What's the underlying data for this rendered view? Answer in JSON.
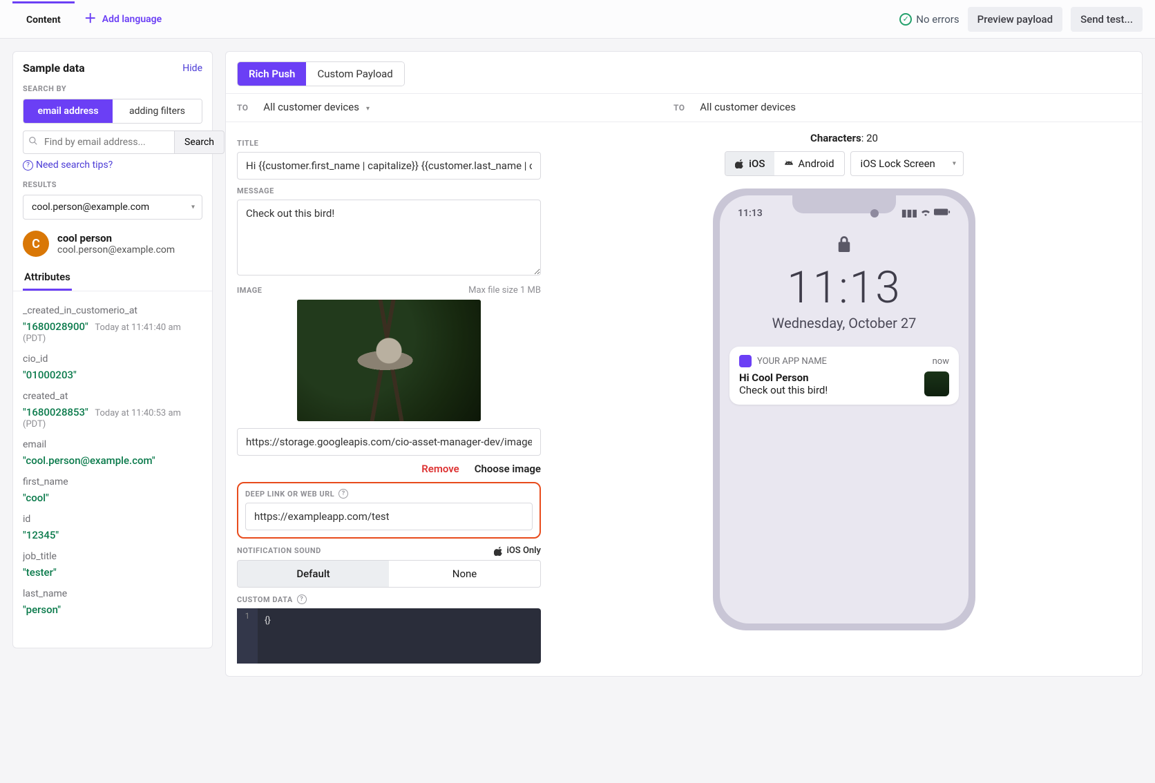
{
  "topbar": {
    "tab": "Content",
    "add_language": "Add language",
    "no_errors": "No errors",
    "preview_payload": "Preview payload",
    "send_test": "Send test..."
  },
  "sidebar": {
    "title": "Sample data",
    "hide": "Hide",
    "search_by": "SEARCH BY",
    "toggle": {
      "email": "email address",
      "filters": "adding filters"
    },
    "search_placeholder": "Find by email address...",
    "search_btn": "Search",
    "tips": "Need search tips?",
    "results_lbl": "RESULTS",
    "result_value": "cool.person@example.com",
    "person": {
      "initial": "C",
      "name": "cool person",
      "email": "cool.person@example.com"
    },
    "attributes_tab": "Attributes",
    "attrs": [
      {
        "k": "_created_in_customerio_at",
        "v": "\"1680028900\"",
        "meta": "Today at 11:41:40 am (PDT)"
      },
      {
        "k": "cio_id",
        "v": "\"01000203\"",
        "meta": ""
      },
      {
        "k": "created_at",
        "v": "\"1680028853\"",
        "meta": "Today at 11:40:53 am (PDT)"
      },
      {
        "k": "email",
        "v": "\"cool.person@example.com\"",
        "meta": ""
      },
      {
        "k": "first_name",
        "v": "\"cool\"",
        "meta": ""
      },
      {
        "k": "id",
        "v": "\"12345\"",
        "meta": ""
      },
      {
        "k": "job_title",
        "v": "\"tester\"",
        "meta": ""
      },
      {
        "k": "last_name",
        "v": "\"person\"",
        "meta": ""
      }
    ]
  },
  "editor": {
    "tabs": {
      "rich": "Rich Push",
      "custom": "Custom Payload"
    },
    "to_lbl": "TO",
    "to_value": "All customer devices",
    "title_lbl": "TITLE",
    "title_val": "Hi {{customer.first_name | capitalize}} {{customer.last_name | capitalize}}",
    "message_lbl": "MESSAGE",
    "message_val": "Check out this bird!",
    "image_lbl": "IMAGE",
    "image_aside": "Max file size 1 MB",
    "image_url": "https://storage.googleapis.com/cio-asset-manager-dev/images/client-",
    "remove": "Remove",
    "choose": "Choose image",
    "deeplink_lbl": "DEEP LINK OR WEB URL",
    "deeplink_val": "https://exampleapp.com/test",
    "sound_lbl": "NOTIFICATION SOUND",
    "ios_only": "iOS Only",
    "sound": {
      "default": "Default",
      "none": "None"
    },
    "custom_data_lbl": "CUSTOM DATA",
    "custom_data_code": "{}"
  },
  "preview": {
    "characters_lbl": "Characters",
    "characters_val": "20",
    "platform": {
      "ios": "iOS",
      "android": "Android"
    },
    "screen_select": "iOS Lock Screen",
    "status_time": "11:13",
    "lock_time": "11:13",
    "lock_date": "Wednesday, October 27",
    "app_name": "YOUR APP NAME",
    "notif_when": "now",
    "notif_title": "Hi Cool Person",
    "notif_msg": "Check out this bird!"
  }
}
